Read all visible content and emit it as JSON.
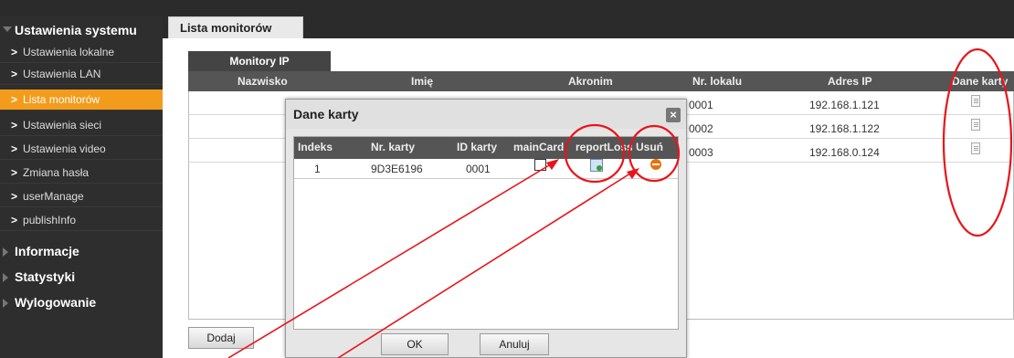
{
  "sidebar": {
    "section_system": "Ustawienia systemu",
    "items": [
      {
        "label": "Ustawienia lokalne"
      },
      {
        "label": "Ustawienia LAN"
      },
      {
        "label": "Lista monitorów"
      },
      {
        "label": "Ustawienia sieci"
      },
      {
        "label": "Ustawienia video"
      },
      {
        "label": "Zmiana hasła"
      },
      {
        "label": "userManage"
      },
      {
        "label": "publishInfo"
      }
    ],
    "section_info": "Informacje",
    "section_stats": "Statystyki",
    "section_logout": "Wylogowanie",
    "active_color": "#f39c1b"
  },
  "main": {
    "tab_label": "Lista monitorów",
    "sub_tab_label": "Monitory IP",
    "columns": [
      "Nazwisko",
      "Imię",
      "Akronim",
      "Nr. lokalu",
      "Adres IP",
      "Dane karty"
    ],
    "rows": [
      {
        "unit": "0001",
        "ip": "192.168.1.121",
        "card_icon": "document-icon"
      },
      {
        "unit": "0002",
        "ip": "192.168.1.122",
        "card_icon": "document-icon"
      },
      {
        "unit": "0003",
        "ip": "192.168.0.124",
        "card_icon": "document-icon"
      }
    ],
    "add_button": "Dodaj"
  },
  "dialog": {
    "title": "Dane karty",
    "close_label": "×",
    "columns": [
      "Indeks",
      "Nr. karty",
      "ID karty",
      "mainCard",
      "reportLoss",
      "Usuń"
    ],
    "rows": [
      {
        "index": "1",
        "card_no": "9D3E6196",
        "card_id": "0001",
        "main_card": false
      }
    ],
    "ok_button": "OK",
    "cancel_button": "Anuluj"
  },
  "annotation_color": "#e8141b"
}
